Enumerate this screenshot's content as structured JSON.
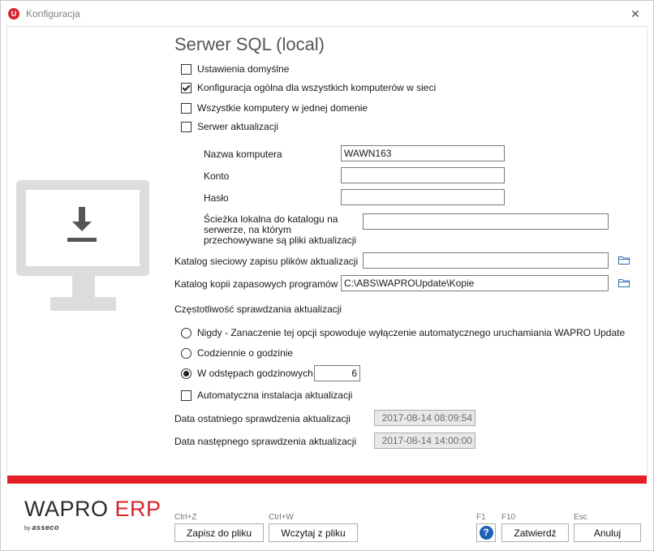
{
  "window": {
    "title": "Konfiguracja",
    "app_icon_letter": "U",
    "close_glyph": "✕"
  },
  "heading": "Serwer SQL (local)",
  "options": {
    "default_settings": {
      "label": "Ustawienia domyślne",
      "checked": false
    },
    "general_config": {
      "label": "Konfiguracja ogólna dla wszystkich komputerów w sieci",
      "checked": true
    },
    "one_domain": {
      "label": "Wszystkie komputery w jednej domenie",
      "checked": false
    },
    "update_server": {
      "label": "Serwer aktualizacji",
      "checked": false
    }
  },
  "fields": {
    "computer_name": {
      "label": "Nazwa komputera",
      "value": "WAWN163"
    },
    "account": {
      "label": "Konto",
      "value": ""
    },
    "password": {
      "label": "Hasło",
      "value": ""
    },
    "local_path": {
      "label_lines": [
        "Ścieżka lokalna do katalogu na",
        "serwerze, na którym",
        "przechowywane są pliki aktualizacji"
      ],
      "value": ""
    },
    "network_catalog": {
      "label": "Katalog sieciowy zapisu plików aktualizacji",
      "value": ""
    },
    "backup_catalog": {
      "label": "Katalog kopii zapasowych programów",
      "value": "C:\\ABS\\WAPROUpdate\\Kopie"
    }
  },
  "frequency": {
    "title": "Częstotliwość sprawdzania aktualizacji",
    "never": {
      "label": "Nigdy - Zanaczenie tej opcji spowoduje wyłączenie automatycznego uruchamiania WAPRO Update",
      "checked": false
    },
    "daily": {
      "label": "Codziennie o godzinie",
      "checked": false
    },
    "hourly": {
      "label": "W odstępach godzinowych",
      "checked": true,
      "value": "6"
    }
  },
  "auto_install": {
    "label": "Automatyczna instalacja aktualizacji",
    "checked": false
  },
  "last_check": {
    "label": "Data ostatniego sprawdzenia aktualizacji",
    "value": "2017-08-14 08:09:54"
  },
  "next_check": {
    "label": "Data następnego sprawdzenia aktualizacji",
    "value": "2017-08-14 14:00:00"
  },
  "footer": {
    "logo_wapro": "WAPRO",
    "logo_erp": "ERP",
    "logo_by": "by",
    "logo_asseco": "asseco",
    "save": {
      "hotkey": "Ctrl+Z",
      "label": "Zapisz do pliku"
    },
    "load": {
      "hotkey": "Ctrl+W",
      "label": "Wczytaj z pliku"
    },
    "help": {
      "hotkey": "F1",
      "glyph": "?"
    },
    "confirm": {
      "hotkey": "F10",
      "label": "Zatwierdź"
    },
    "cancel": {
      "hotkey": "Esc",
      "label": "Anuluj"
    }
  },
  "colors": {
    "accent_red": "#e31e24",
    "help_blue": "#1f5fb5",
    "folder_blue": "#2e6fb0"
  }
}
